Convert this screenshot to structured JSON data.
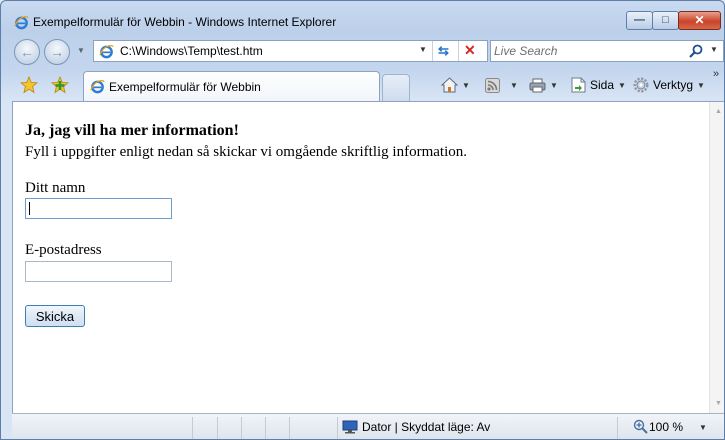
{
  "window": {
    "title": "Exempelformulär för Webbin - Windows Internet Explorer",
    "minimize_glyph": "—",
    "maximize_glyph": "□",
    "close_glyph": "✕"
  },
  "addressbar": {
    "url": "C:\\Windows\\Temp\\test.htm"
  },
  "search": {
    "placeholder": "Live Search"
  },
  "tabs": [
    {
      "label": "Exempelformulär för Webbin",
      "icon": "ie-page-icon"
    }
  ],
  "commandbar": {
    "page_label": "Sida",
    "tools_label": "Verktyg"
  },
  "page": {
    "heading": "Ja, jag vill ha mer information!",
    "intro": "Fyll i uppgifter enligt nedan så skickar vi omgående skriftlig information.",
    "name_label": "Ditt namn",
    "name_value": "",
    "email_label": "E-postadress",
    "email_value": "",
    "submit_label": "Skicka"
  },
  "statusbar": {
    "zone_text": "Dator | Skyddat läge: Av",
    "zoom": "100 %"
  },
  "colors": {
    "accent": "#3c7fb1",
    "close_button": "#c9452a"
  }
}
